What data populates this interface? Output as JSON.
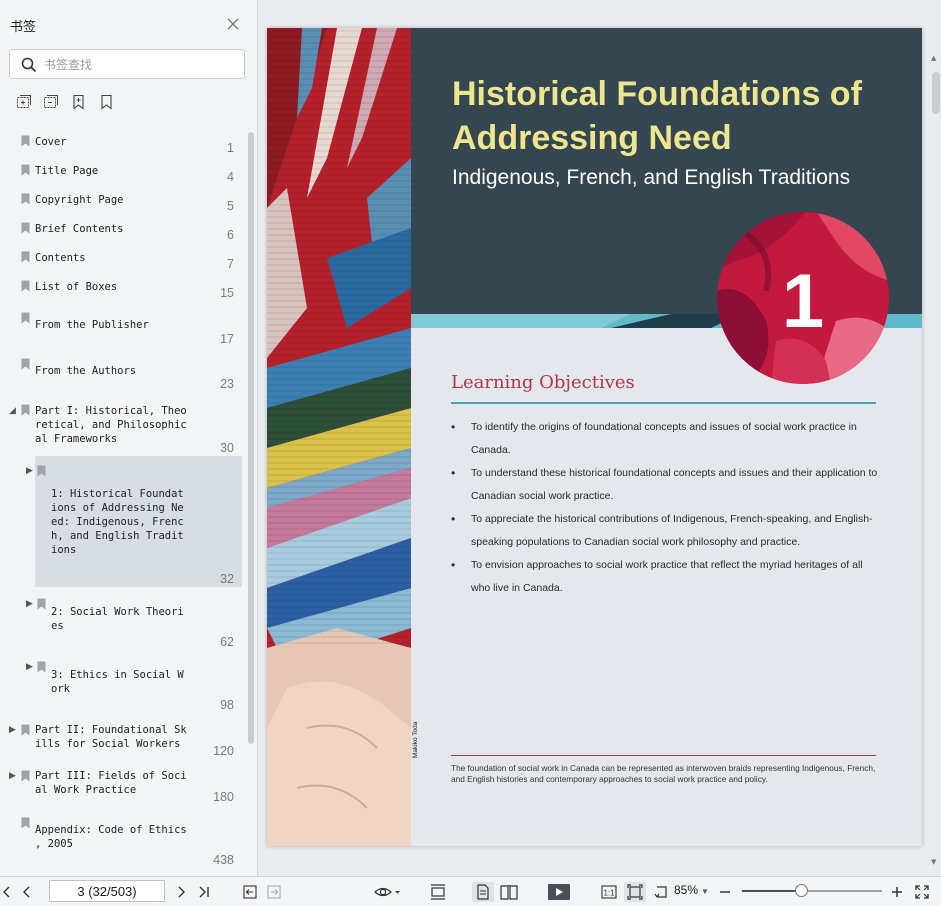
{
  "sidebar": {
    "title": "书签",
    "search_placeholder": "书签查找",
    "bookmarks": [
      {
        "label": "Cover",
        "page": "1"
      },
      {
        "label": "Title Page",
        "page": "4"
      },
      {
        "label": "Copyright Page",
        "page": "5"
      },
      {
        "label": "Brief Contents",
        "page": "6"
      },
      {
        "label": "Contents",
        "page": "7"
      },
      {
        "label": "List of Boxes",
        "page": "15"
      },
      {
        "label": "From the Publisher",
        "page": "17"
      },
      {
        "label": "From the Authors",
        "page": "23"
      },
      {
        "label": "Part I: Historical, Theo\nretical, and Philosophic\nal Frameworks",
        "page": "30"
      },
      {
        "label": "1: Historical Foundat\nions of Addressing Ne\ned: Indigenous, Frenc\nh, and English Tradit\nions",
        "page": "32"
      },
      {
        "label": "2: Social Work Theori\nes",
        "page": "62"
      },
      {
        "label": "3: Ethics in Social W\nork",
        "page": "98"
      },
      {
        "label": "Part II: Foundational Sk\nills for Social Workers",
        "page": "120"
      },
      {
        "label": "Part III: Fields of Soci\nal Work Practice",
        "page": "180"
      },
      {
        "label": "Appendix: Code of Ethics\n, 2005",
        "page": "438"
      }
    ]
  },
  "document": {
    "chapter_title": "Historical Foundations of Addressing Need",
    "chapter_subtitle": "Indigenous, French, and English Traditions",
    "chapter_number": "1",
    "learning_objectives_title": "Learning Objectives",
    "objectives": [
      "To identify the origins of foundational concepts and issues of social work practice in Canada.",
      "To understand these historical foundational concepts and issues and their application to Canadian social work practice.",
      "To appreciate the historical contributions of Indigenous, French-speaking, and English-speaking populations to Canadian social work philosophy and practice.",
      "To envision approaches to social work practice that reflect the myriad heritages of all who live in Canada."
    ],
    "caption": "The foundation of social work in Canada can be represented as interwoven braids representing Indigenous, French, and English histories and contemporary approaches to social work practice and policy.",
    "photo_credit": "Makiko Toda"
  },
  "toolbar": {
    "page_indicator": "3 (32/503)",
    "zoom": "85%",
    "zoom_fraction": 0.42
  },
  "colors": {
    "header_band": "#34464f",
    "title_yellow": "#ede58f",
    "accent_red": "#b0354b",
    "accent_teal": "#47a3b5"
  }
}
